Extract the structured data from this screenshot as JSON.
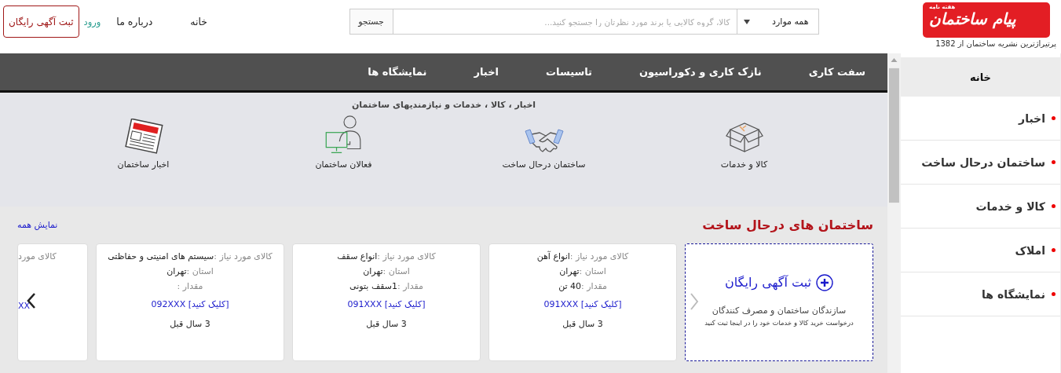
{
  "header": {
    "logo_kicker": "هفته نامه",
    "logo_title": "پیام ساختمان",
    "tagline": "پرتیراژترین نشریه ساختمان از 1382",
    "search": {
      "category": "همه موارد",
      "placeholder": "کالا، گروه کالایی یا برند مورد نظرتان را جستجو کنید...",
      "button": "جستجو"
    },
    "links": [
      {
        "label": "خانه"
      },
      {
        "label": "درباره ما"
      }
    ],
    "login": "ورود",
    "post_button": "ثبت آگهی رایگان"
  },
  "main_nav": [
    "سفت کاری",
    "نازک کاری و دکوراسیون",
    "تاسیسات",
    "اخبار",
    "نمایشگاه ها"
  ],
  "categories": {
    "title": "اخبار ، کالا ، خدمات و نیازمندیهای ساختمان",
    "items": [
      {
        "label": "کالا و خدمات",
        "kind": "box"
      },
      {
        "label": "ساختمان درحال ساخت",
        "kind": "handshake"
      },
      {
        "label": "فعالان ساختمان",
        "kind": "person"
      },
      {
        "label": "اخبار ساختمان",
        "kind": "newspaper"
      }
    ]
  },
  "section": {
    "title": "ساختمان های درحال ساخت",
    "show_all": "نمایش همه",
    "add_card": {
      "title": "ثبت آگهی رایگان",
      "subtitle": "سازندگان ساختمان و مصرف کنندگان",
      "note": "درخواست خرید کالا و خدمات خود را در اینجا ثبت کنید"
    },
    "cards": [
      {
        "need_label": "کالای مورد نیاز :",
        "need": "انواع آهن",
        "province_label": "استان :",
        "province": "تهران",
        "amount_label": "مقدار :",
        "amount": "40 تن",
        "phone": "091XXX [کلیک کنید]",
        "age": "3 سال قبل"
      },
      {
        "need_label": "کالای مورد نیاز :",
        "need": "انواع سقف",
        "province_label": "استان :",
        "province": "تهران",
        "amount_label": "مقدار :",
        "amount": "1سقف بتونی",
        "phone": "091XXX [کلیک کنید]",
        "age": "3 سال قبل"
      },
      {
        "need_label": "کالای مورد نیاز :",
        "need": "سیستم های امنیتی و حفاظتی",
        "province_label": "استان :",
        "province": "تهران",
        "amount_label": "مقدار :",
        "phone": "092XXX [کلیک کنید]",
        "age": "3 سال قبل"
      }
    ],
    "partial_card": {
      "need_label": "کالای مورد",
      "phone": "XX"
    }
  },
  "sidebar": {
    "items": [
      {
        "label": "خانه",
        "selected": true
      },
      {
        "label": "اخبار",
        "selected": false
      },
      {
        "label": "ساختمان درحال ساخت",
        "selected": false
      },
      {
        "label": "کالا و خدمات",
        "selected": false
      },
      {
        "label": "املاک",
        "selected": false
      },
      {
        "label": "نمایشگاه ها",
        "selected": false
      }
    ]
  }
}
